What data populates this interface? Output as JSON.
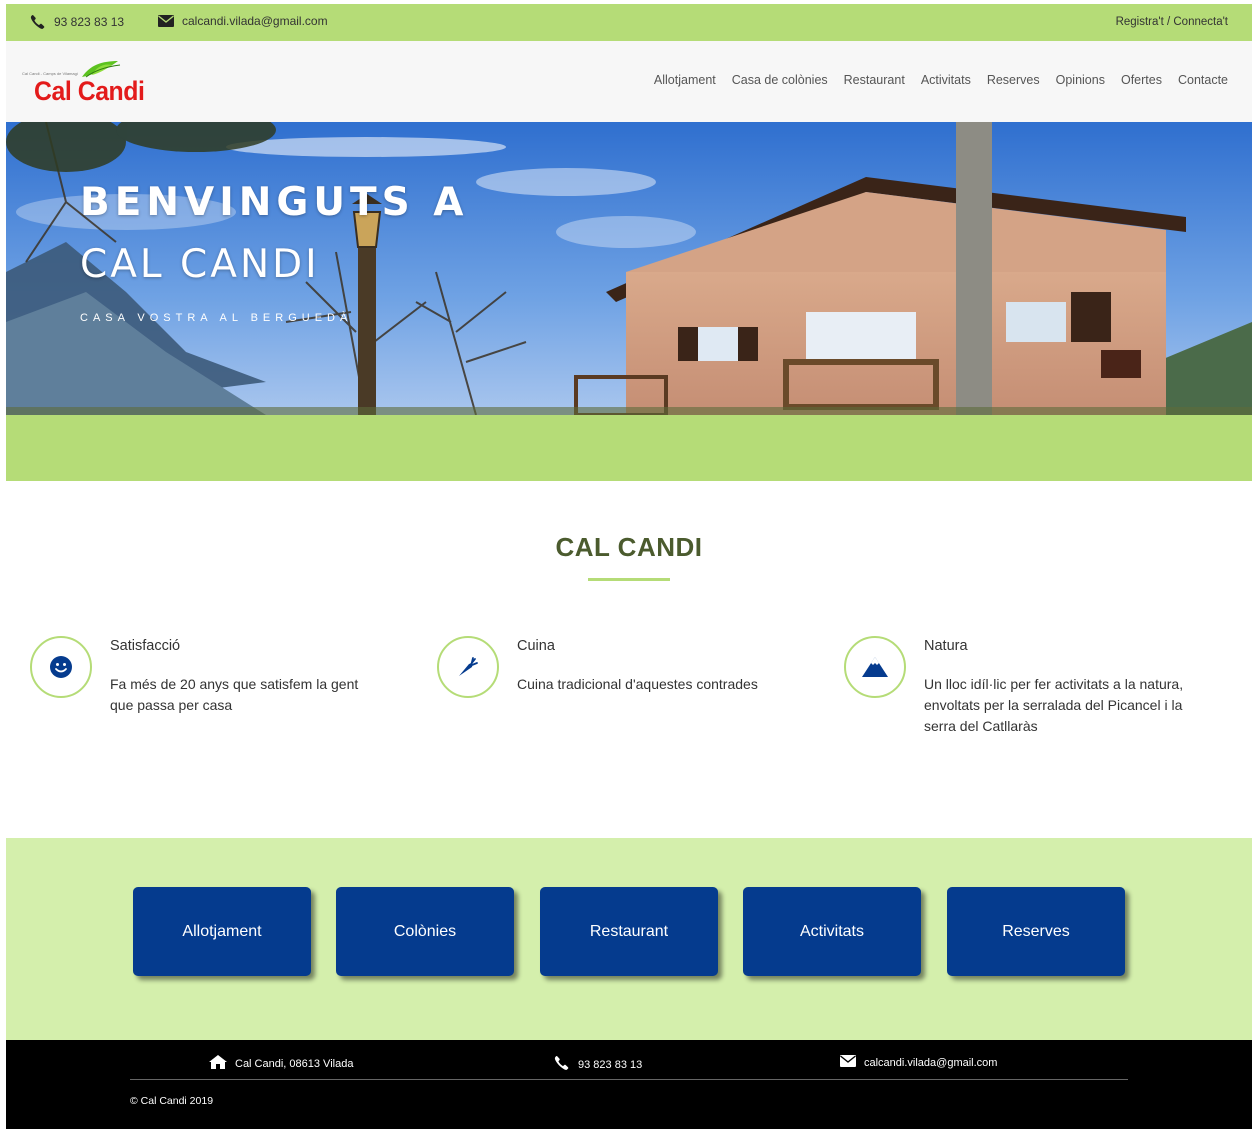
{
  "topbar": {
    "phone": "93 823 83 13",
    "email": "calcandi.vilada@gmail.com",
    "login": "Registra't / Connecta't"
  },
  "logo": {
    "tagline": "Cal Candi - Camps de Vilamagí",
    "name": "Cal Candi"
  },
  "nav": {
    "items": [
      "Allotjament",
      "Casa de colònies",
      "Restaurant",
      "Activitats",
      "Reserves",
      "Opinions",
      "Ofertes",
      "Contacte"
    ]
  },
  "hero": {
    "line1": "BENVINGUTS A",
    "line2": "CAL CANDI",
    "subtitle": "CASA VOSTRA AL BERGUEDÀ"
  },
  "section": {
    "title": "CAL CANDI"
  },
  "features": [
    {
      "icon": "smile-icon",
      "title": "Satisfacció",
      "text": "Fa més de 20 anys que satisfem la gent que passa per casa"
    },
    {
      "icon": "carrot-icon",
      "title": "Cuina",
      "text": "Cuina tradicional d'aquestes contrades"
    },
    {
      "icon": "mountain-icon",
      "title": "Natura",
      "text": "Un lloc idíl·lic per fer activitats a la natura, envoltats per la serralada del Picancel i la serra del Catllaràs"
    }
  ],
  "buttons": [
    "Allotjament",
    "Colònies",
    "Restaurant",
    "Activitats",
    "Reserves"
  ],
  "footer": {
    "address": "Cal Candi, 08613 Vilada",
    "phone": "93 823 83 13",
    "email": "calcandi.vilada@gmail.com",
    "copyright": "© Cal Candi 2019"
  },
  "colors": {
    "accent_green": "#b5dc77",
    "light_green": "#d4efac",
    "button_blue": "#053b8e",
    "logo_red": "#e31b1b",
    "title_green": "#4b5b2e"
  }
}
